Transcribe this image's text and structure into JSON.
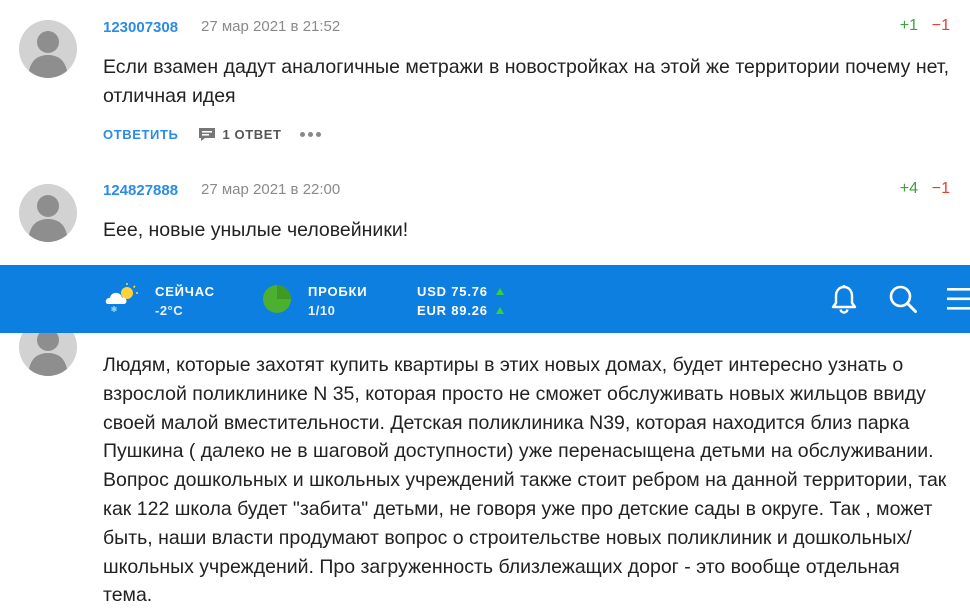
{
  "comments": [
    {
      "author": "123007308",
      "date": "27 мар 2021 в 21:52",
      "plus": "+1",
      "minus": "−1",
      "text": "Если взамен дадут аналогичные метражи в новостройках на этой же территории почему нет, отличная идея",
      "reply_label": "ОТВЕТИТЬ",
      "replies_label": "1 ОТВЕТ"
    },
    {
      "author": "124827888",
      "date": "27 мар 2021 в 22:00",
      "plus": "+4",
      "minus": "−1",
      "text": "Еее, новые унылые человейники!"
    },
    {
      "text": "Людям, которые захотят купить квартиры в этих новых домах, будет интересно узнать о взрослой поликлинике N 35, которая просто не сможет обслуживать новых жильцов ввиду своей малой вместительности. Детская поликлиника N39, которая находится близ парка Пушкина ( далеко не в шаговой доступности) уже перенасыщена детьми на обслуживании. Вопрос дошкольных и школьных учреждений также стоит ребром на данной территории, так как 122 школа будет \"забита\" детьми, не говоря уже про детские сады в округе. Так , может быть, наши власти продумают вопрос о строительстве новых поликлиник и дошкольных/школьных учреждений. Про загруженность близлежащих дорог - это вообще отдельная тема."
    }
  ],
  "topbar": {
    "weather_label": "СЕЙЧАС",
    "weather_value": "-2°C",
    "weather_icon": "cloudy-snow-icon",
    "traffic_label": "ПРОБКИ",
    "traffic_value": "1/10",
    "traffic_color": "#4caf2f",
    "usd": "USD 75.76",
    "eur": "EUR 89.26",
    "icons": [
      "bell-icon",
      "search-icon",
      "menu-icon"
    ]
  },
  "colors": {
    "brand": "#0d7fe0",
    "link": "#2b8ce6",
    "positive": "#3ca23c",
    "negative": "#e0412f"
  }
}
